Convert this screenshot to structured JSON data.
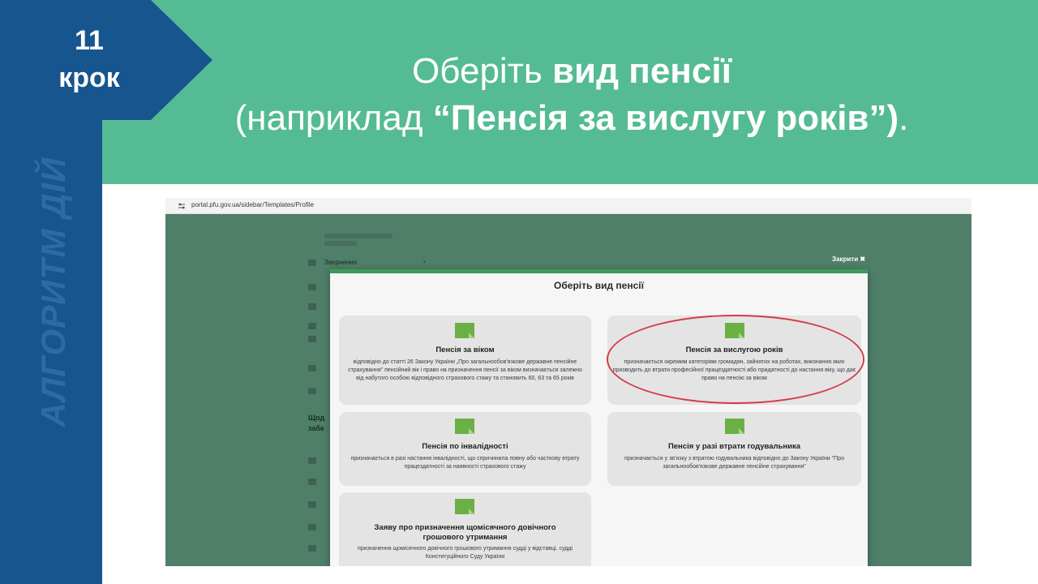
{
  "step": {
    "number": "11",
    "word": "крок"
  },
  "side_label": "АЛГОРИТМ ДІЙ",
  "title": {
    "line1_a": "Оберіть ",
    "line1_b": "вид пенсії",
    "line2_a": "(наприклад ",
    "line2_b": "“Пенсія за вислугу років”)",
    "line2_c": "."
  },
  "browser": {
    "url": "portal.pfu.gov.ua/sidebar/Templates/Profile"
  },
  "page": {
    "sidebar_appeals": "Звернення",
    "sidebar_chevron": "›",
    "close_link": "Закрити ✖",
    "sidebar_heading_1": "Щод",
    "sidebar_heading_2": "забе"
  },
  "modal": {
    "title": "Оберіть вид пенсії",
    "cards": [
      {
        "title": "Пенсія за віком",
        "desc": "відповідно до статті 26 Закону України „Про загальнообов'язкове державне пенсійне страхування\" пенсійний вік і право на призначення пенсії за віком визначається залежно від набутого особою відповідного страхового стажу та становить 60, 63 та 65 років"
      },
      {
        "title": "Пенсія за вислугою років",
        "desc": "призначається окремим категоріям громадян, зайнятих на роботах, виконання яких призводить до втрати професійної працездатності або придатності до настання віку, що дає право на пенсію за віком"
      },
      {
        "title": "Пенсія по інвалідності",
        "desc": "призначається в разі настання інвалідності, що спричинила повну або часткову втрату працездатності за наявності страхового стажу"
      },
      {
        "title": "Пенсія у разі втрати годувальника",
        "desc": "призначається у зв'язку з втратою годувальника відповідно до Закону України \"Про загальнообов'язкове державне пенсійне страхування\""
      },
      {
        "title": "Заяву про призначення щомісячного довічного грошового утримання",
        "desc": "призначення щомісячного довічного грошового утримання судді у відставці, судді Конституційного Суду України"
      }
    ]
  },
  "colors": {
    "header_green": "#55bb94",
    "left_blue": "#17558f",
    "modal_accent": "#3e9b57",
    "highlight_red": "#d63a45"
  }
}
